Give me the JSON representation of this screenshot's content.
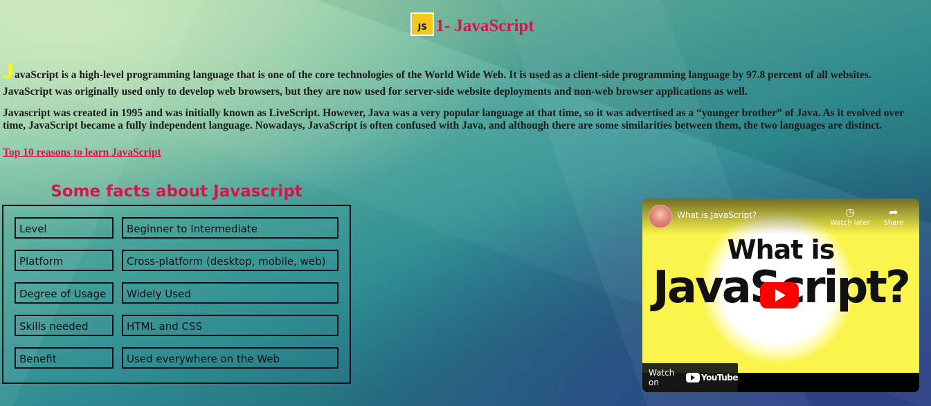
{
  "header": {
    "logo_text": "JS",
    "title": "1- JavaScript"
  },
  "intro": {
    "drop_cap": "J",
    "p1_line1": "avaScript is a high-level programming language that is one of the core technologies of the World Wide Web. It is used as a client-side programming language by 97.8 percent of all websites.",
    "p1_line2": "JavaScript was originally used only to develop web browsers, but they are now used for server-side website deployments and non-web browser applications as well.",
    "p2_line1": "Javascript was created in 1995 and was initially known as LiveScript. However, Java was a very popular language at that time, so it was advertised as a “younger brother” of Java. As it evolved over",
    "p2_line2": "time, JavaScript became a fully independent language. Nowadays, JavaScript is often confused with Java, and although there are some similarities between them, the two languages are distinct.",
    "link_text": "Top 10 reasons to learn JavaScript"
  },
  "facts": {
    "title": "Some facts about Javascript",
    "rows": [
      {
        "key": "Level",
        "value": "Beginner to Intermediate"
      },
      {
        "key": "Platform",
        "value": "Cross-platform (desktop, mobile, web)"
      },
      {
        "key": "Degree of Usage",
        "value": "Widely Used"
      },
      {
        "key": "Skills needed",
        "value": "HTML and CSS"
      },
      {
        "key": "Benefit",
        "value": "Used everywhere on the Web"
      }
    ]
  },
  "video": {
    "title": "What is JavaScript?",
    "watch_later": "Watch later",
    "share": "Share",
    "thumb_line1": "What is",
    "thumb_line2": "JavaScript?",
    "watch_on": "Watch on",
    "youtube": "YouTube"
  },
  "colors": {
    "accent": "#d4164a",
    "drop_cap": "#f8f81c",
    "thumbnail_bg": "#fbf44c",
    "play_red": "#ff0000"
  }
}
